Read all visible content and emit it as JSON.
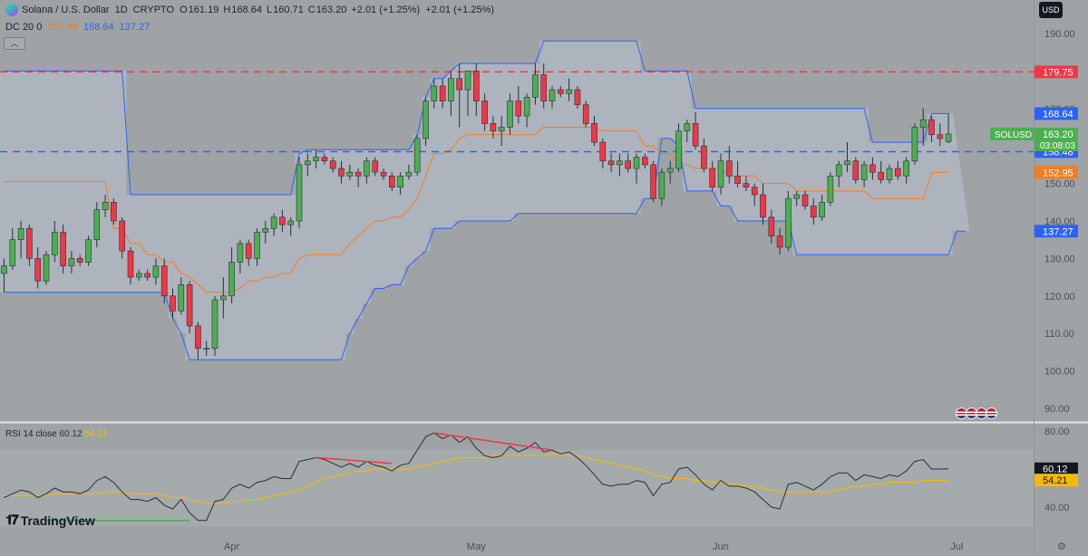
{
  "header": {
    "symbol": "Solana / U.S. Dollar",
    "interval": "1D",
    "exchange": "CRYPTO",
    "o_label": "O",
    "o": "161.19",
    "h_label": "H",
    "h": "168.64",
    "l_label": "L",
    "l": "160.71",
    "c_label": "C",
    "c": "163.20",
    "change": "+2.01 (+1.25%)",
    "change2": "+2.01 (+1.25%)"
  },
  "indicator": {
    "name": "DC 20 0",
    "mid": "152.95",
    "upper": "168.64",
    "lower": "137.27"
  },
  "currency_button": "USD",
  "rsi_legend": {
    "name": "RSI 14 close",
    "rsi": "60.12",
    "ma": "54.21"
  },
  "brand": "TradingView",
  "colors": {
    "up": "#4caf50",
    "down": "#f23645",
    "dc_band": "#2962ff",
    "dc_mid": "#f57c1f",
    "rsi": "#2a2e39",
    "rsi_ma": "#f5b90a"
  },
  "chart_data": {
    "type": "candlestick",
    "title": "Solana / U.S. Dollar",
    "price_axis": {
      "min": 88,
      "max": 194,
      "ticks": [
        "190.00",
        "180.00",
        "170.00",
        "160.00",
        "150.00",
        "140.00",
        "130.00",
        "120.00",
        "110.00",
        "100.00",
        "90.00"
      ]
    },
    "time_axis": {
      "labels": [
        "Apr",
        "May",
        "Jun",
        "Jul"
      ],
      "label_index": [
        27,
        56,
        85,
        113
      ]
    },
    "candles": [
      [
        126.0,
        130.0,
        121.0,
        128.0
      ],
      [
        128.0,
        138.0,
        127.0,
        135.0
      ],
      [
        135.0,
        140.0,
        130.0,
        138.0
      ],
      [
        138.0,
        139.0,
        128.0,
        130.0
      ],
      [
        130.0,
        133.0,
        122.0,
        124.0
      ],
      [
        124.0,
        132.0,
        123.0,
        131.0
      ],
      [
        131.0,
        140.0,
        129.0,
        137.0
      ],
      [
        137.0,
        139.0,
        126.0,
        128.0
      ],
      [
        128.0,
        132.0,
        126.0,
        130.0
      ],
      [
        130.0,
        131.0,
        128.0,
        129.0
      ],
      [
        129.0,
        136.0,
        128.0,
        135.0
      ],
      [
        135.0,
        145.0,
        133.0,
        143.0
      ],
      [
        143.0,
        147.0,
        141.0,
        145.0
      ],
      [
        145.0,
        146.0,
        139.0,
        140.0
      ],
      [
        140.0,
        141.0,
        130.0,
        132.0
      ],
      [
        132.0,
        133.0,
        123.0,
        125.0
      ],
      [
        125.0,
        127.0,
        124.0,
        126.0
      ],
      [
        126.0,
        127.0,
        124.0,
        125.0
      ],
      [
        125.0,
        130.0,
        123.0,
        128.0
      ],
      [
        128.0,
        130.0,
        118.0,
        120.0
      ],
      [
        120.0,
        122.0,
        114.0,
        116.0
      ],
      [
        116.0,
        125.0,
        115.0,
        123.0
      ],
      [
        123.0,
        124.0,
        110.0,
        112.0
      ],
      [
        112.0,
        113.0,
        103.0,
        106.0
      ],
      [
        106.0,
        108.0,
        104.0,
        106.0
      ],
      [
        106.0,
        120.0,
        104.0,
        119.0
      ],
      [
        119.0,
        125.0,
        114.0,
        120.0
      ],
      [
        120.0,
        133.0,
        118.0,
        129.0
      ],
      [
        129.0,
        135.0,
        126.0,
        134.0
      ],
      [
        134.0,
        135.0,
        128.0,
        130.0
      ],
      [
        130.0,
        138.0,
        128.0,
        137.0
      ],
      [
        137.0,
        140.0,
        134.0,
        138.0
      ],
      [
        138.0,
        142.0,
        136.0,
        141.0
      ],
      [
        141.0,
        143.0,
        137.0,
        139.0
      ],
      [
        139.0,
        141.0,
        136.0,
        140.0
      ],
      [
        140.0,
        157.0,
        138.0,
        155.0
      ],
      [
        155.0,
        158.0,
        152.0,
        156.0
      ],
      [
        156.0,
        159.0,
        154.0,
        157.0
      ],
      [
        157.0,
        158.0,
        155.0,
        156.0
      ],
      [
        156.0,
        157.0,
        153.0,
        154.0
      ],
      [
        154.0,
        156.0,
        150.0,
        152.0
      ],
      [
        152.0,
        155.0,
        151.0,
        153.0
      ],
      [
        153.0,
        154.0,
        149.0,
        152.0
      ],
      [
        152.0,
        157.0,
        150.0,
        156.0
      ],
      [
        156.0,
        157.0,
        152.0,
        153.0
      ],
      [
        153.0,
        154.0,
        151.0,
        152.0
      ],
      [
        152.0,
        153.0,
        148.0,
        149.0
      ],
      [
        149.0,
        153.0,
        147.0,
        152.0
      ],
      [
        152.0,
        155.0,
        151.0,
        153.0
      ],
      [
        153.0,
        163.0,
        152.0,
        162.0
      ],
      [
        162.0,
        173.0,
        160.0,
        172.0
      ],
      [
        172.0,
        178.0,
        170.0,
        176.0
      ],
      [
        176.0,
        178.0,
        170.0,
        172.0
      ],
      [
        172.0,
        180.0,
        168.0,
        178.0
      ],
      [
        178.0,
        182.0,
        165.0,
        175.0
      ],
      [
        175.0,
        180.0,
        168.0,
        180.0
      ],
      [
        180.0,
        182.0,
        168.0,
        172.0
      ],
      [
        172.0,
        174.0,
        164.0,
        166.0
      ],
      [
        166.0,
        168.0,
        162.0,
        164.0
      ],
      [
        164.0,
        168.0,
        160.0,
        165.0
      ],
      [
        165.0,
        174.0,
        163.0,
        172.0
      ],
      [
        172.0,
        176.0,
        166.0,
        168.0
      ],
      [
        168.0,
        174.0,
        165.0,
        173.0
      ],
      [
        173.0,
        182.0,
        171.0,
        179.0
      ],
      [
        179.0,
        182.0,
        170.0,
        172.0
      ],
      [
        172.0,
        176.0,
        170.0,
        175.0
      ],
      [
        175.0,
        176.0,
        173.0,
        174.0
      ],
      [
        174.0,
        178.0,
        172.0,
        175.0
      ],
      [
        175.0,
        176.0,
        170.0,
        171.0
      ],
      [
        171.0,
        172.0,
        165.0,
        166.0
      ],
      [
        166.0,
        168.0,
        160.0,
        161.0
      ],
      [
        161.0,
        162.0,
        154.0,
        156.0
      ],
      [
        156.0,
        158.0,
        153.0,
        155.0
      ],
      [
        155.0,
        158.0,
        152.0,
        156.0
      ],
      [
        156.0,
        158.0,
        153.0,
        154.0
      ],
      [
        154.0,
        158.0,
        150.0,
        157.0
      ],
      [
        157.0,
        158.0,
        154.0,
        155.0
      ],
      [
        155.0,
        156.0,
        145.0,
        146.0
      ],
      [
        146.0,
        154.0,
        144.0,
        153.0
      ],
      [
        153.0,
        156.0,
        150.0,
        154.0
      ],
      [
        154.0,
        166.0,
        153.0,
        164.0
      ],
      [
        164.0,
        167.0,
        161.0,
        166.0
      ],
      [
        166.0,
        169.0,
        159.0,
        160.0
      ],
      [
        160.0,
        162.0,
        153.0,
        154.0
      ],
      [
        154.0,
        156.0,
        148.0,
        149.0
      ],
      [
        149.0,
        158.0,
        147.0,
        156.0
      ],
      [
        156.0,
        160.0,
        150.0,
        152.0
      ],
      [
        152.0,
        156.0,
        149.0,
        150.0
      ],
      [
        150.0,
        152.0,
        148.0,
        149.0
      ],
      [
        149.0,
        150.0,
        144.0,
        147.0
      ],
      [
        147.0,
        150.0,
        139.0,
        141.0
      ],
      [
        141.0,
        143.0,
        134.0,
        136.0
      ],
      [
        136.0,
        138.0,
        131.0,
        133.0
      ],
      [
        133.0,
        148.0,
        132.0,
        146.0
      ],
      [
        146.0,
        148.0,
        144.0,
        147.0
      ],
      [
        147.0,
        148.0,
        143.0,
        144.0
      ],
      [
        144.0,
        146.0,
        139.0,
        141.0
      ],
      [
        141.0,
        147.0,
        140.0,
        145.0
      ],
      [
        145.0,
        153.0,
        144.0,
        152.0
      ],
      [
        152.0,
        156.0,
        149.0,
        155.0
      ],
      [
        155.0,
        161.0,
        153.0,
        156.0
      ],
      [
        156.0,
        157.0,
        150.0,
        151.0
      ],
      [
        151.0,
        156.0,
        149.0,
        155.0
      ],
      [
        155.0,
        157.0,
        151.0,
        153.0
      ],
      [
        153.0,
        156.0,
        150.0,
        151.0
      ],
      [
        151.0,
        155.0,
        150.0,
        154.0
      ],
      [
        154.0,
        156.0,
        151.0,
        152.0
      ],
      [
        152.0,
        157.0,
        150.0,
        156.0
      ],
      [
        156.0,
        166.0,
        155.0,
        165.0
      ],
      [
        165.0,
        170.0,
        160.0,
        167.0
      ],
      [
        167.0,
        168.0,
        161.0,
        163.0
      ],
      [
        163.0,
        166.0,
        160.0,
        162.0
      ],
      [
        161.19,
        168.64,
        160.71,
        163.2
      ]
    ],
    "donchian_upper": [
      180,
      180,
      180,
      180,
      180,
      180,
      180,
      180,
      180,
      180,
      180,
      180,
      180,
      180,
      180,
      147,
      147,
      147,
      147,
      147,
      147,
      147,
      147,
      147,
      147,
      147,
      147,
      147,
      147,
      147,
      147,
      147,
      147,
      147,
      147,
      158,
      159,
      159,
      159,
      159,
      159,
      159,
      159,
      159,
      159,
      159,
      159,
      159,
      159,
      163,
      173,
      178,
      178,
      180,
      182,
      182,
      182,
      182,
      182,
      182,
      182,
      182,
      182,
      182,
      188,
      188,
      188,
      188,
      188,
      188,
      188,
      188,
      188,
      188,
      188,
      188,
      180,
      180,
      180,
      180,
      180,
      180,
      170,
      170,
      170,
      170,
      170,
      170,
      170,
      170,
      170,
      170,
      170,
      170,
      170,
      170,
      170,
      170,
      170,
      170,
      170,
      170,
      170,
      161,
      161,
      161,
      161,
      161,
      161,
      161,
      168.64,
      168.64,
      168.64
    ],
    "donchian_lower": [
      121,
      121,
      121,
      121,
      121,
      121,
      121,
      121,
      121,
      121,
      121,
      121,
      121,
      121,
      121,
      121,
      121,
      121,
      121,
      121,
      114,
      110,
      103,
      103,
      103,
      103,
      103,
      103,
      103,
      103,
      103,
      103,
      103,
      103,
      103,
      103,
      103,
      103,
      103,
      103,
      103,
      110,
      114,
      118,
      122,
      122,
      123,
      123,
      128,
      130,
      132,
      138,
      138,
      138,
      140,
      140,
      140,
      140,
      140,
      140,
      140,
      142,
      142,
      142,
      142,
      142,
      142,
      142,
      142,
      142,
      142,
      142,
      142,
      142,
      142,
      142,
      146,
      146,
      162,
      162,
      160,
      148,
      148,
      148,
      148,
      144,
      144,
      140,
      140,
      140,
      140,
      140,
      140,
      140,
      131,
      131,
      131,
      131,
      131,
      131,
      131,
      131,
      131,
      131,
      131,
      131,
      131,
      131,
      131,
      131,
      131,
      131,
      131,
      137.27,
      137.27
    ],
    "donchian_mid": [
      150.5,
      150.5,
      150.5,
      150.5,
      150.5,
      150.5,
      150.5,
      150.5,
      150.5,
      150.5,
      150.5,
      150.5,
      150.5,
      138,
      138,
      134,
      134,
      131,
      131,
      129,
      129,
      126,
      125,
      123,
      121,
      121,
      121,
      121,
      122,
      124,
      124,
      125,
      125,
      126,
      126,
      130,
      131,
      131,
      131,
      131,
      131,
      134,
      136,
      138,
      140,
      140,
      141,
      141,
      143,
      146,
      152,
      158,
      158,
      159,
      162,
      163,
      163,
      163,
      163,
      163,
      163,
      163,
      163,
      163,
      165,
      165,
      165,
      165,
      165,
      165,
      165,
      164,
      164,
      164,
      164,
      164,
      160,
      160,
      158,
      158,
      155,
      155,
      154,
      154,
      154,
      154,
      152,
      152,
      152,
      152,
      150,
      150,
      150,
      150,
      148,
      148,
      148,
      148,
      148,
      148,
      148,
      148,
      148,
      146,
      146,
      146,
      146,
      146,
      146,
      146,
      152.95,
      152.95,
      152.95
    ],
    "horizontal_levels": [
      {
        "value": 179.75,
        "color": "#f23645",
        "style": "dashed"
      },
      {
        "value": 158.48,
        "color": "#2962ff",
        "style": "dashed"
      }
    ],
    "price_labels": [
      {
        "text": "179.75",
        "value": 179.75,
        "color": "#f23645"
      },
      {
        "text": "168.64",
        "value": 168.64,
        "color": "#2962ff"
      },
      {
        "text": "158.48",
        "value": 158.48,
        "color": "#2962ff"
      },
      {
        "text": "152.95",
        "value": 152.95,
        "color": "#f57c1f"
      },
      {
        "text": "137.27",
        "value": 137.27,
        "color": "#2962ff"
      }
    ],
    "last_price": {
      "symbol": "SOLUSD",
      "price": "163.20",
      "countdown": "03:08:03",
      "value": 163.2
    },
    "rsi": {
      "axis": {
        "min": 30,
        "max": 80,
        "ticks": [
          "80.00",
          "40.00"
        ]
      },
      "band": [
        70,
        30
      ],
      "values": [
        45,
        47,
        49,
        48,
        45,
        47,
        50,
        48,
        48,
        47,
        49,
        54,
        56,
        53,
        48,
        44,
        44,
        43,
        45,
        41,
        39,
        44,
        37,
        33,
        33,
        43,
        44,
        50,
        52,
        50,
        53,
        54,
        56,
        55,
        55,
        64,
        65,
        66,
        65,
        63,
        61,
        63,
        61,
        64,
        62,
        61,
        59,
        62,
        63,
        70,
        77,
        79,
        76,
        78,
        74,
        77,
        71,
        67,
        66,
        67,
        72,
        69,
        71,
        74,
        69,
        70,
        68,
        69,
        66,
        62,
        57,
        52,
        51,
        52,
        52,
        54,
        53,
        46,
        52,
        53,
        60,
        61,
        57,
        52,
        49,
        54,
        51,
        51,
        50,
        48,
        44,
        40,
        39,
        52,
        53,
        51,
        49,
        52,
        56,
        58,
        58,
        54,
        57,
        56,
        55,
        57,
        56,
        59,
        64,
        65,
        60,
        60,
        60.12
      ],
      "ma": [
        46,
        46,
        46,
        46,
        46,
        46,
        47,
        47,
        47,
        47,
        47,
        47,
        48,
        48,
        48,
        47,
        47,
        47,
        47,
        46,
        45,
        45,
        44,
        43,
        42,
        42,
        42,
        43,
        43,
        44,
        44,
        45,
        46,
        47,
        48,
        49,
        51,
        53,
        55,
        56,
        57,
        58,
        59,
        59,
        60,
        60,
        60,
        60,
        60,
        61,
        62,
        63,
        64,
        65,
        66,
        66,
        66,
        66,
        67,
        67,
        67,
        67,
        67,
        67,
        67,
        68,
        68,
        67,
        67,
        66,
        65,
        64,
        63,
        62,
        61,
        60,
        59,
        57,
        56,
        55,
        55,
        55,
        54,
        54,
        53,
        53,
        52,
        52,
        51,
        51,
        50,
        49,
        48,
        48,
        48,
        48,
        48,
        48,
        48,
        49,
        50,
        51,
        51,
        52,
        52,
        53,
        53,
        53,
        53,
        54,
        54,
        54,
        54.21
      ],
      "rsi_label": {
        "text": "60.12",
        "value": 60.12
      },
      "ma_label": {
        "text": "54.21",
        "value": 54.21
      },
      "divergence_lines": [
        {
          "from": [
            37,
            66
          ],
          "to": [
            46,
            63
          ],
          "color": "#f23645"
        },
        {
          "from": [
            51,
            79
          ],
          "to": [
            65,
            70
          ],
          "color": "#f23645"
        },
        {
          "from": [
            5,
            33
          ],
          "to": [
            22,
            33
          ],
          "color": "#4caf50"
        }
      ]
    }
  }
}
